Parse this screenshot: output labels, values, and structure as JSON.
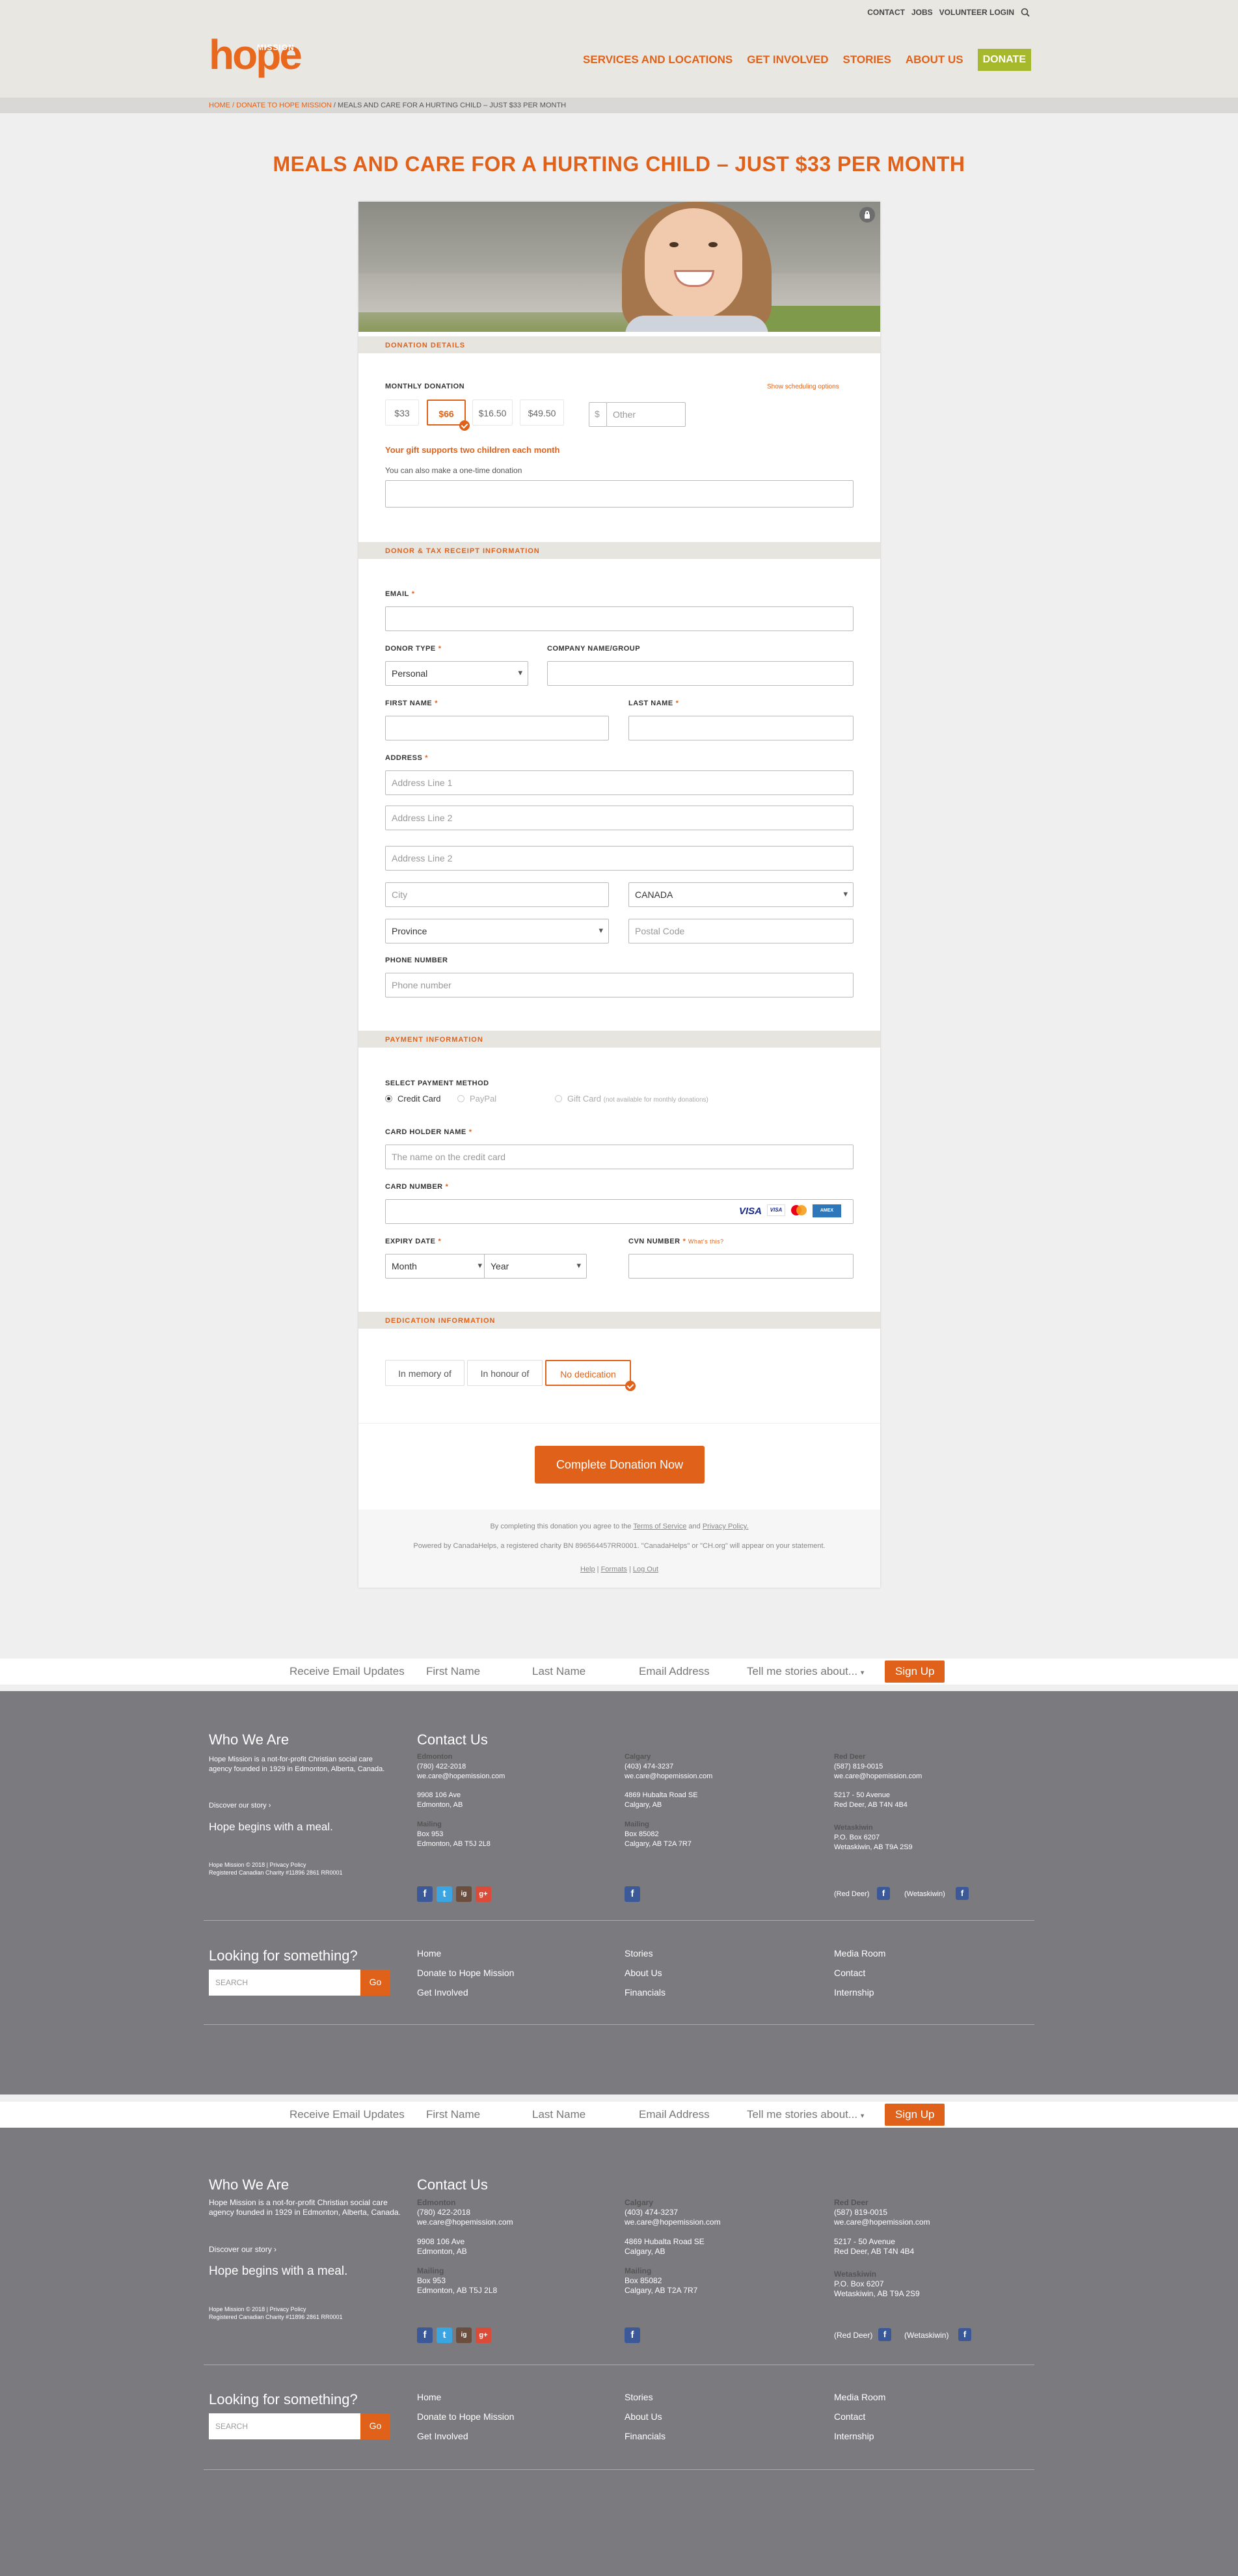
{
  "header": {
    "top_links": [
      "CONTACT",
      "JOBS",
      "VOLUNTEER LOGIN"
    ],
    "logo_word": "hope",
    "logo_sub": "MISSION",
    "nav": [
      "SERVICES AND LOCATIONS",
      "GET INVOLVED",
      "STORIES",
      "ABOUT US"
    ],
    "donate": "DONATE"
  },
  "breadcrumb": {
    "home": "HOME",
    "sep": " / ",
    "parent": "DONATE TO HOPE MISSION",
    "current": " / MEALS AND CARE FOR A HURTING CHILD – JUST $33 PER MONTH"
  },
  "page_title": "MEALS AND CARE FOR A HURTING CHILD – JUST $33 PER MONTH",
  "donation": {
    "section": "DONATION DETAILS",
    "monthly_label": "MONTHLY DONATION",
    "schedule_link": "Show scheduling options",
    "amounts": [
      "$33",
      "$66",
      "$16.50",
      "$49.50"
    ],
    "selected_amount": "$66",
    "currency": "$",
    "other_placeholder": "Other",
    "impact": "Your gift supports two children each month",
    "onetime": "You can also make a one-time donation"
  },
  "donor": {
    "section": "DONOR & TAX RECEIPT INFORMATION",
    "email": "EMAIL",
    "donor_type": "DONOR TYPE",
    "donor_type_value": "Personal",
    "company": "COMPANY NAME/GROUP",
    "first_name": "FIRST NAME",
    "last_name": "LAST NAME",
    "address": "ADDRESS",
    "addr1": "Address Line 1",
    "addr2": "Address Line 2",
    "addr3": "Address Line 2",
    "city": "City",
    "country": "CANADA",
    "province": "Province",
    "postal": "Postal Code",
    "phone": "PHONE NUMBER",
    "phone_placeholder": "Phone number",
    "required": "*"
  },
  "payment": {
    "section": "PAYMENT INFORMATION",
    "method": "SELECT PAYMENT METHOD",
    "credit": "Credit Card",
    "paypal": "PayPal",
    "gift": "Gift Card",
    "gift_note": "(not available for monthly donations)",
    "holder": "CARD HOLDER NAME",
    "holder_placeholder": "The name on the credit card",
    "number": "CARD NUMBER",
    "cards": [
      "VISA",
      "VISA",
      "MC",
      "AMEX"
    ],
    "expiry": "EXPIRY DATE",
    "month": "Month",
    "year": "Year",
    "cvn": "CVN NUMBER",
    "cvn_help": "What's this?"
  },
  "dedication": {
    "section": "DEDICATION INFORMATION",
    "options": [
      "In memory of",
      "In honour of",
      "No dedication"
    ]
  },
  "cta": "Complete Donation Now",
  "legal": {
    "agree_pre": "By completing this donation you agree to the",
    "terms": "Terms of Service",
    "and": "and",
    "privacy": "Privacy Policy.",
    "powered": "Powered by CanadaHelps, a registered charity BN 896564457RR0001. \"CanadaHelps\" or \"CH.org\" will appear on your statement.",
    "help": "Help",
    "forms": "Formats",
    "logout": "Log Out",
    "pipe": "|"
  },
  "signup": {
    "label": "Receive Email Updates",
    "first": "First Name",
    "last": "Last Name",
    "email": "Email Address",
    "stories": "Tell me stories about...",
    "button": "Sign Up"
  },
  "footer": {
    "who_title": "Who We Are",
    "who_text": "Hope Mission is a not-for-profit Christian social care agency founded in 1929 in Edmonton, Alberta, Canada.",
    "discover": "Discover our story ›",
    "tagline": "Hope begins with a meal.",
    "copy1": "Hope Mission © 2018 | Privacy Policy",
    "copy2": "Registered Canadian Charity #11896 2861 RR0001",
    "contact_title": "Contact Us",
    "edmonton": {
      "name": "Edmonton",
      "phone": "(780) 422-2018",
      "email": "we.care@hopemission.com",
      "addr1": "9908 106 Ave",
      "addr2": "Edmonton, AB",
      "mailing": "Mailing",
      "box": "Box 953",
      "mail2": "Edmonton, AB T5J 2L8"
    },
    "calgary": {
      "name": "Calgary",
      "phone": "(403) 474-3237",
      "email": "we.care@hopemission.com",
      "addr1": "4869 Hubalta Road SE",
      "addr2": "Calgary, AB",
      "mailing": "Mailing",
      "box": "Box 85082",
      "mail2": "Calgary, AB T2A 7R7"
    },
    "reddeer": {
      "name": "Red Deer",
      "phone": "(587) 819-0015",
      "email": "we.care@hopemission.com",
      "addr1": "5217 - 50 Avenue",
      "addr2": "Red Deer, AB T4N 4B4",
      "wet": "Wetaskiwin",
      "box": "P.O. Box 6207",
      "mail2": "Wetaskiwin, AB T9A 2S9",
      "rd_tag": "(Red Deer)",
      "wk_tag": "(Wetaskiwin)"
    },
    "looking": "Looking for something?",
    "search_placeholder": "SEARCH",
    "go": "Go",
    "links_col1": [
      "Home",
      "Donate to Hope Mission",
      "Get Involved"
    ],
    "links_col2": [
      "Stories",
      "About Us",
      "Financials"
    ],
    "links_col3": [
      "Media Room",
      "Contact",
      "Internship"
    ],
    "social": [
      "f",
      "t",
      "ig",
      "g+"
    ]
  }
}
